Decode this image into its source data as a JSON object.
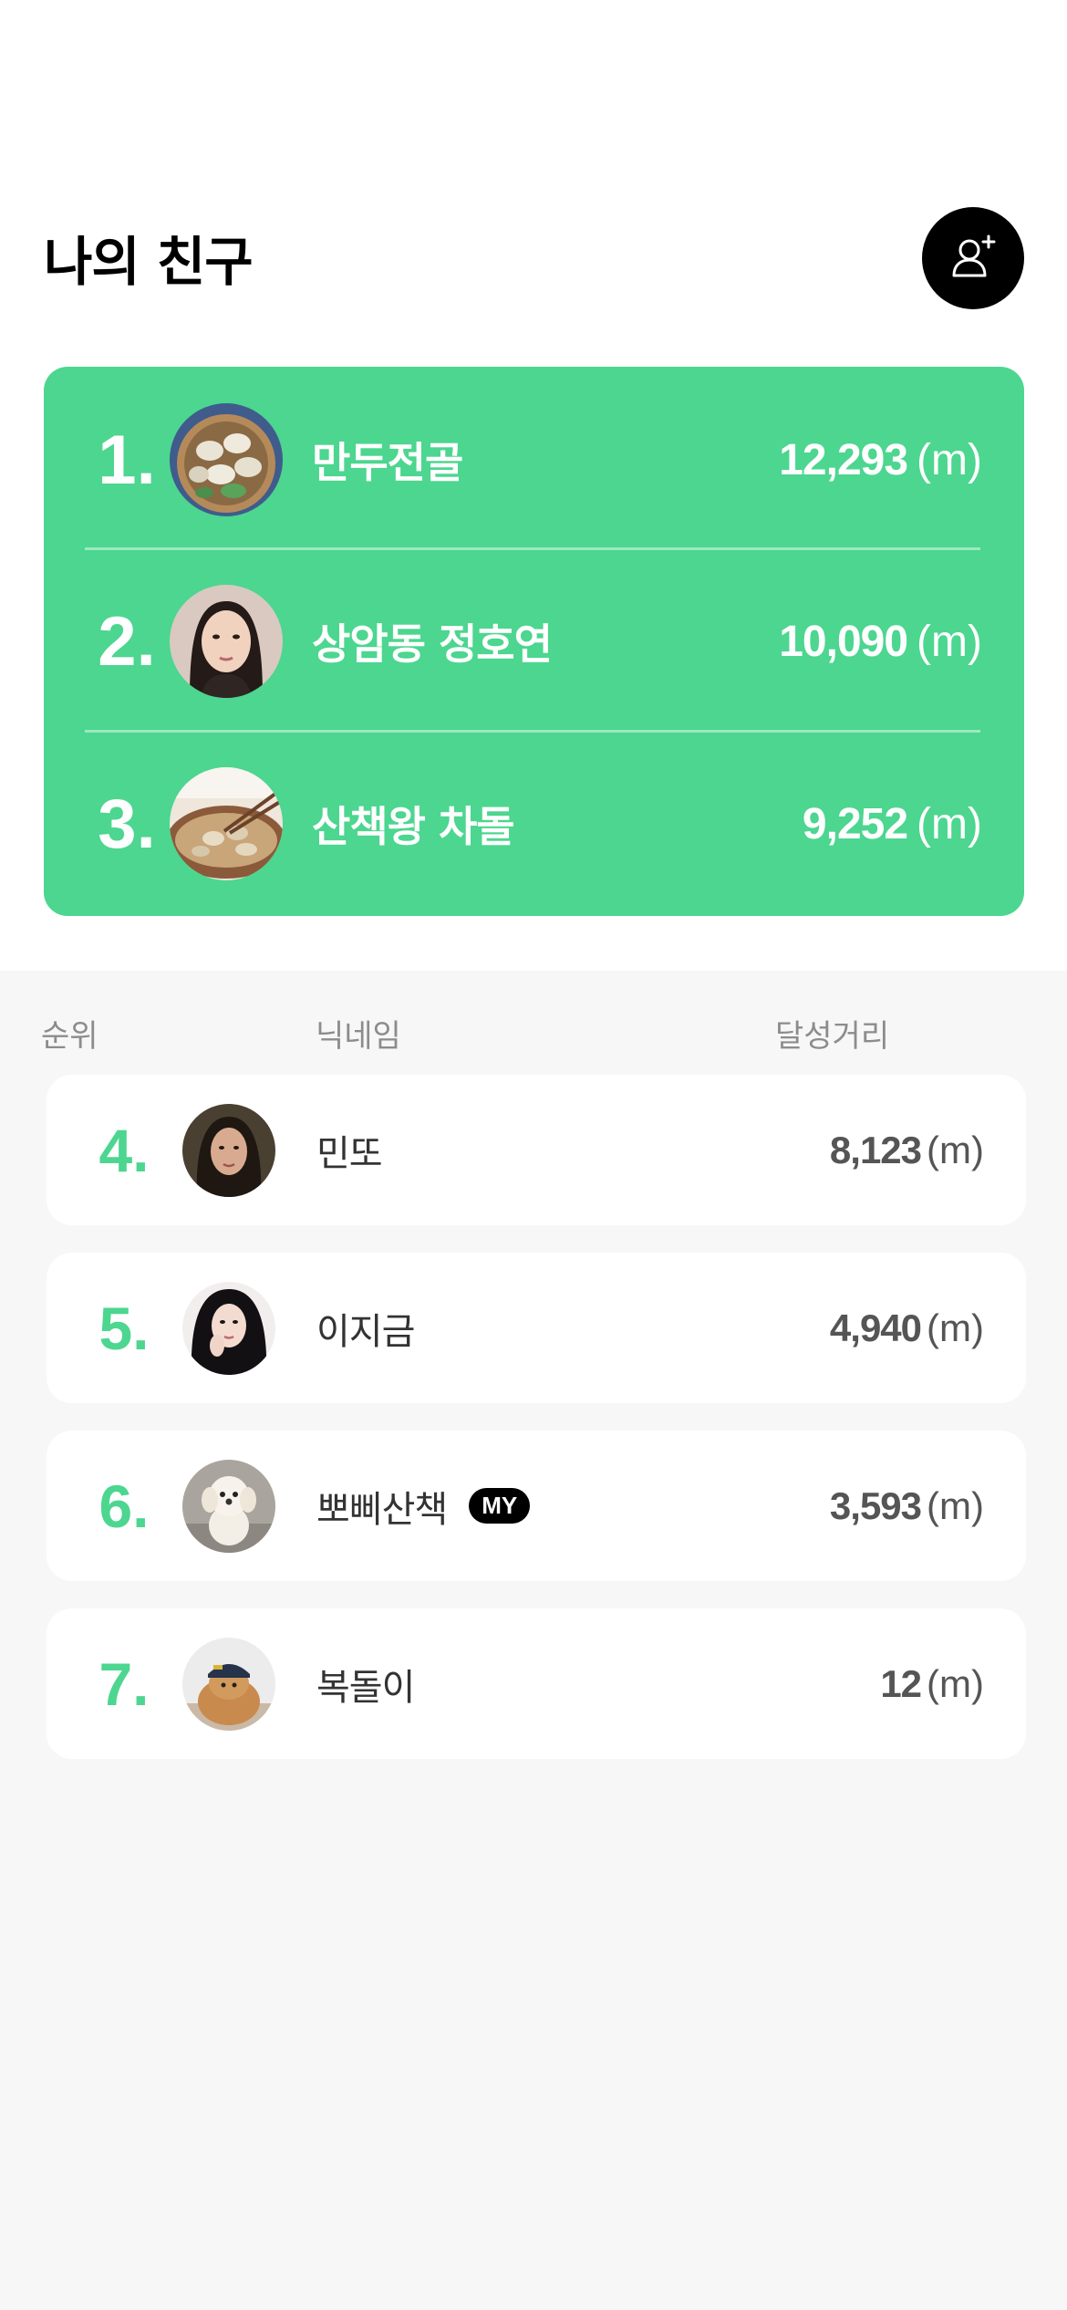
{
  "header": {
    "title": "나의 친구",
    "add_friend_icon": "add-user-icon"
  },
  "top3": [
    {
      "rank": "1.",
      "name": "만두전골",
      "distance": "12,293",
      "unit": "(m)",
      "avatar": "dumplings-photo"
    },
    {
      "rank": "2.",
      "name": "상암동 정호연",
      "distance": "10,090",
      "unit": "(m)",
      "avatar": "person-portrait"
    },
    {
      "rank": "3.",
      "name": "산책왕 차돌",
      "distance": "9,252",
      "unit": "(m)",
      "avatar": "food-photo"
    }
  ],
  "columns": {
    "rank": "순위",
    "nickname": "닉네임",
    "distance": "달성거리"
  },
  "list": [
    {
      "rank": "4.",
      "name": "민또",
      "distance": "8,123",
      "unit": "(m)",
      "avatar": "person-portrait"
    },
    {
      "rank": "5.",
      "name": "이지금",
      "distance": "4,940",
      "unit": "(m)",
      "avatar": "person-portrait"
    },
    {
      "rank": "6.",
      "name": "뽀삐산책",
      "badge": "MY",
      "distance": "3,593",
      "unit": "(m)",
      "avatar": "puppy-photo"
    },
    {
      "rank": "7.",
      "name": "복돌이",
      "distance": "12",
      "unit": "(m)",
      "avatar": "dog-with-hat-photo"
    }
  ],
  "colors": {
    "accent": "#4cd68f",
    "background_bottom": "#f7f7f7",
    "header_label": "#8c8c8c"
  }
}
